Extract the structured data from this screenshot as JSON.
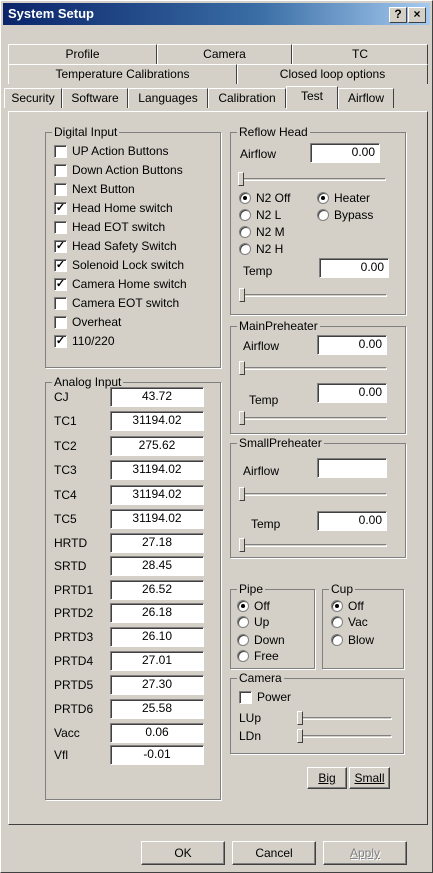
{
  "window": {
    "title": "System Setup",
    "help_glyph": "?",
    "close_glyph": "×"
  },
  "tabs": {
    "row1": [
      "Profile",
      "Camera",
      "TC"
    ],
    "row2": [
      "Temperature Calibrations",
      "Closed loop options"
    ],
    "row3": [
      "Security",
      "Software",
      "Languages",
      "Calibration",
      "Test",
      "Airflow"
    ],
    "active": "Test"
  },
  "digital_input": {
    "legend": "Digital Input",
    "items": [
      {
        "label": "UP Action Buttons",
        "checked": false
      },
      {
        "label": "Down Action Buttons",
        "checked": false
      },
      {
        "label": "Next Button",
        "checked": false
      },
      {
        "label": "Head Home switch",
        "checked": true
      },
      {
        "label": "Head EOT switch",
        "checked": false
      },
      {
        "label": "Head Safety Switch",
        "checked": true
      },
      {
        "label": "Solenoid Lock switch",
        "checked": true
      },
      {
        "label": "Camera Home switch",
        "checked": true
      },
      {
        "label": "Camera EOT switch",
        "checked": false
      },
      {
        "label": "Overheat",
        "checked": false
      },
      {
        "label": "110/220",
        "checked": true
      }
    ]
  },
  "analog_input": {
    "legend": "Analog Input",
    "items": [
      {
        "label": "CJ",
        "value": "43.72"
      },
      {
        "label": "TC1",
        "value": "31194.02"
      },
      {
        "label": "TC2",
        "value": "275.62"
      },
      {
        "label": "TC3",
        "value": "31194.02"
      },
      {
        "label": "TC4",
        "value": "31194.02"
      },
      {
        "label": "TC5",
        "value": "31194.02"
      },
      {
        "label": "HRTD",
        "value": "27.18"
      },
      {
        "label": "SRTD",
        "value": "28.45"
      },
      {
        "label": "PRTD1",
        "value": "26.52"
      },
      {
        "label": "PRTD2",
        "value": "26.18"
      },
      {
        "label": "PRTD3",
        "value": "26.10"
      },
      {
        "label": "PRTD4",
        "value": "27.01"
      },
      {
        "label": "PRTD5",
        "value": "27.30"
      },
      {
        "label": "PRTD6",
        "value": "25.58"
      },
      {
        "label": "Vacc",
        "value": "0.06"
      },
      {
        "label": "Vfl",
        "value": "-0.01"
      }
    ]
  },
  "reflow_head": {
    "legend": "Reflow Head",
    "airflow_label": "Airflow",
    "airflow_value": "0.00",
    "gas_options": [
      {
        "label": "N2 Off",
        "selected": true
      },
      {
        "label": "N2 L",
        "selected": false
      },
      {
        "label": "N2 M",
        "selected": false
      },
      {
        "label": "N2 H",
        "selected": false
      }
    ],
    "heater_options": [
      {
        "label": "Heater",
        "selected": true
      },
      {
        "label": "Bypass",
        "selected": false
      }
    ],
    "temp_label": "Temp",
    "temp_value": "0.00"
  },
  "main_preheater": {
    "legend": "MainPreheater",
    "airflow_label": "Airflow",
    "airflow_value": "0.00",
    "temp_label": "Temp",
    "temp_value": "0.00"
  },
  "small_preheater": {
    "legend": "SmallPreheater",
    "airflow_label": "Airflow",
    "airflow_value": "",
    "temp_label": "Temp",
    "temp_value": "0.00"
  },
  "pipe": {
    "legend": "Pipe",
    "options": [
      {
        "label": "Off",
        "selected": true
      },
      {
        "label": "Up",
        "selected": false
      },
      {
        "label": "Down",
        "selected": false
      },
      {
        "label": "Free",
        "selected": false
      }
    ]
  },
  "cup": {
    "legend": "Cup",
    "options": [
      {
        "label": "Off",
        "selected": true
      },
      {
        "label": "Vac",
        "selected": false
      },
      {
        "label": "Blow",
        "selected": false
      }
    ]
  },
  "camera": {
    "legend": "Camera",
    "power_label": "Power",
    "power_checked": false,
    "lup_label": "LUp",
    "ldn_label": "LDn"
  },
  "buttons": {
    "big": "Big",
    "small": "Small",
    "ok": "OK",
    "cancel": "Cancel",
    "apply": "Apply"
  }
}
